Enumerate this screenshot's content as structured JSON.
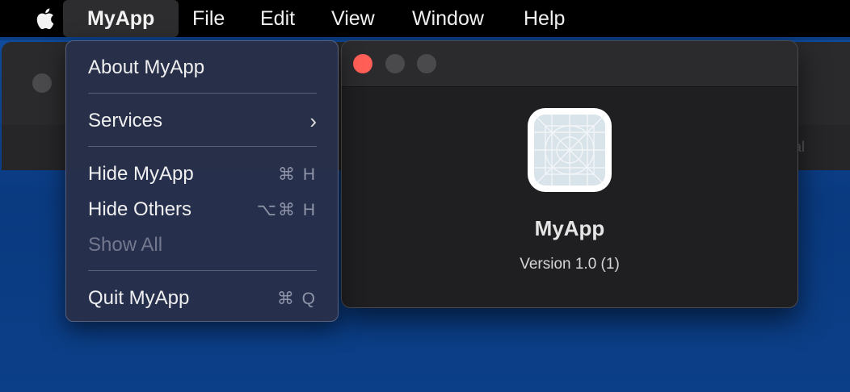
{
  "menubar": {
    "items": [
      {
        "label": "MyApp"
      },
      {
        "label": "File"
      },
      {
        "label": "Edit"
      },
      {
        "label": "View"
      },
      {
        "label": "Window"
      },
      {
        "label": "Help"
      }
    ],
    "apple_icon": "apple-logo-icon"
  },
  "dropdown": {
    "about": "About MyApp",
    "services": "Services",
    "hide_app": "Hide MyApp",
    "hide_app_shortcut": "⌘ H",
    "hide_others": "Hide Others",
    "hide_others_shortcut": "⌥⌘ H",
    "show_all": "Show All",
    "quit": "Quit MyApp",
    "quit_shortcut": "⌘ Q"
  },
  "about_window": {
    "app_name": "MyApp",
    "version": "Version 1.0 (1)",
    "close_color": "#ff5f57"
  },
  "background_window": {
    "partial_text": "al"
  }
}
